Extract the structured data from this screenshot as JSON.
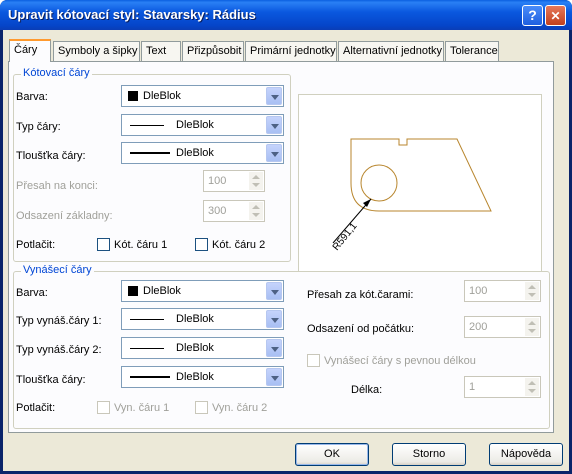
{
  "window": {
    "title": "Upravit kótovací styl: Stavarsky: Rádius",
    "help_glyph": "?",
    "close_glyph": "✕"
  },
  "tabs": [
    {
      "label": "Čáry",
      "active": true
    },
    {
      "label": "Symboly a šipky"
    },
    {
      "label": "Text"
    },
    {
      "label": "Přizpůsobit"
    },
    {
      "label": "Primární jednotky"
    },
    {
      "label": "Alternativní jednotky"
    },
    {
      "label": "Tolerance"
    }
  ],
  "dim_lines": {
    "legend": "Kótovací čáry",
    "color_label": "Barva:",
    "color_value": "DleBlok",
    "linetype_label": "Typ čáry:",
    "linetype_value": "DleBlok",
    "lineweight_label": "Tloušťka čáry:",
    "lineweight_value": "DleBlok",
    "extend_label": "Přesah na konci:",
    "extend_value": "100",
    "baseline_label": "Odsazení základny:",
    "baseline_value": "300",
    "suppress_label": "Potlačit:",
    "suppress_1": "Kót. čáru 1",
    "suppress_2": "Kót. čáru 2"
  },
  "preview": {
    "dimension_text": "R591,1"
  },
  "ext_lines": {
    "legend": "Vynášecí čáry",
    "color_label": "Barva:",
    "color_value": "DleBlok",
    "linetype1_label": "Typ vynáš.čáry 1:",
    "linetype1_value": "DleBlok",
    "linetype2_label": "Typ vynáš.čáry 2:",
    "linetype2_value": "DleBlok",
    "lineweight_label": "Tloušťka čáry:",
    "lineweight_value": "DleBlok",
    "suppress_label": "Potlačit:",
    "suppress_1": "Vyn. čáru 1",
    "suppress_2": "Vyn. čáru 2",
    "beyond_label": "Přesah za kót.čarami:",
    "beyond_value": "100",
    "offset_label": "Odsazení od počátku:",
    "offset_value": "200",
    "fixed_label": "Vynášecí čáry s pevnou délkou",
    "length_label": "Délka:",
    "length_value": "1"
  },
  "buttons": {
    "ok": "OK",
    "cancel": "Storno",
    "help": "Nápověda"
  },
  "colors": {
    "title_bar": "#0a58df",
    "dialog_bg": "#ece9d8",
    "legend_text": "#0046d5",
    "preview_geometry": "#b8862e"
  }
}
